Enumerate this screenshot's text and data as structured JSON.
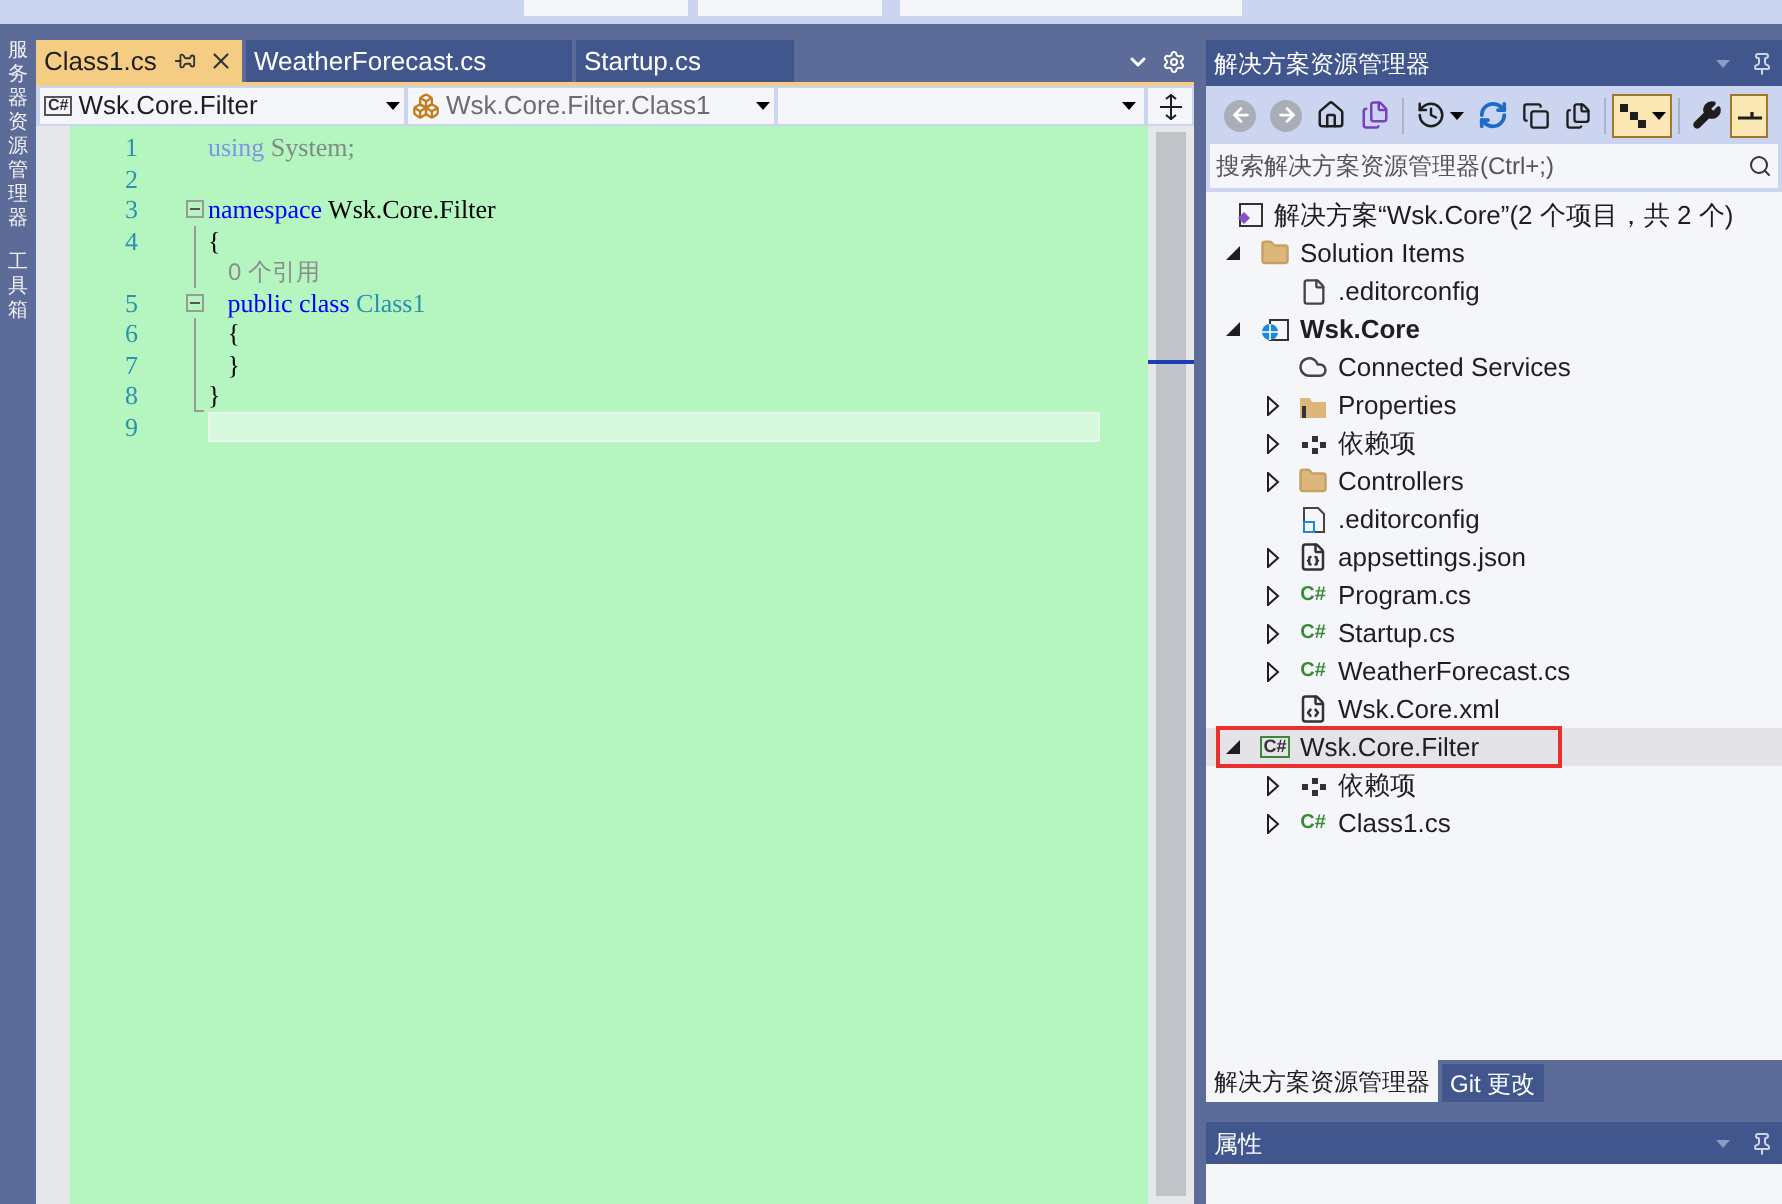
{
  "side_tabs": [
    "服务器资源管理器",
    "工具箱"
  ],
  "editor": {
    "tabs": [
      {
        "label": "Class1.cs",
        "selected": true
      },
      {
        "label": "WeatherForecast.cs",
        "selected": false
      },
      {
        "label": "Startup.cs",
        "selected": false
      }
    ],
    "nav": {
      "project_badge": "C#",
      "project": "Wsk.Core.Filter",
      "type": "Wsk.Core.Filter.Class1"
    },
    "lines": [
      {
        "number": "1",
        "kind": "plain",
        "current": false,
        "tokens": [
          {
            "text": "using",
            "kind": "faded-keyword"
          },
          {
            "text": " System;",
            "kind": "faded"
          }
        ]
      },
      {
        "number": "2",
        "kind": "plain",
        "current": false
      },
      {
        "number": "3",
        "kind": "fold-start",
        "current": false,
        "tokens": [
          {
            "text": "namespace",
            "kind": "keyword"
          },
          {
            "text": " Wsk.Core.Filter",
            "kind": "plain"
          }
        ]
      },
      {
        "number": "4",
        "kind": "fold-body",
        "current": false,
        "tokens": [
          {
            "text": "{",
            "kind": "plain"
          }
        ]
      },
      {
        "kind": "lens",
        "current": false,
        "tokens": [
          {
            "text": "   0 个引用",
            "kind": "lens"
          }
        ]
      },
      {
        "number": "5",
        "kind": "fold-start",
        "current": false,
        "tokens": [
          {
            "text": "   public",
            "kind": "keyword"
          },
          {
            "text": " class",
            "kind": "keyword"
          },
          {
            "text": " Class1",
            "kind": "type"
          }
        ]
      },
      {
        "number": "6",
        "kind": "fold-body",
        "current": false,
        "tokens": [
          {
            "text": "   {",
            "kind": "plain"
          }
        ]
      },
      {
        "number": "7",
        "kind": "fold-body",
        "current": false,
        "tokens": [
          {
            "text": "   }",
            "kind": "plain"
          }
        ]
      },
      {
        "number": "8",
        "kind": "fold-end",
        "current": false,
        "tokens": [
          {
            "text": "}",
            "kind": "plain"
          }
        ]
      },
      {
        "number": "9",
        "kind": "plain",
        "current": true
      }
    ]
  },
  "solution_explorer": {
    "title": "解决方案资源管理器",
    "toolbar": [
      {
        "kind": "back",
        "disabled": true
      },
      {
        "kind": "forward",
        "disabled": true
      },
      {
        "kind": "home"
      },
      {
        "kind": "switch"
      },
      {
        "kind": "sep"
      },
      {
        "kind": "history"
      },
      {
        "kind": "refresh"
      },
      {
        "kind": "collapse"
      },
      {
        "kind": "copy"
      },
      {
        "kind": "sep"
      },
      {
        "kind": "tree",
        "on": true
      },
      {
        "kind": "sep"
      },
      {
        "kind": "wrench"
      },
      {
        "kind": "preview",
        "on": true
      }
    ],
    "search": {
      "placeholder": "搜索解决方案资源管理器(Ctrl+;)"
    },
    "tree": {
      "label": "解决方案“Wsk.Core”(2 个项目，共 2 个)",
      "kind": "solution",
      "selected": false,
      "children": [
        {
          "label": "Solution Items",
          "kind": "folder",
          "expanded": true,
          "selected": false,
          "children": [
            {
              "label": ".editorconfig",
              "kind": "file",
              "selected": false
            }
          ]
        },
        {
          "label": "Wsk.Core",
          "kind": "web",
          "expanded": true,
          "bold": true,
          "selected": false,
          "children": [
            {
              "label": "Connected Services",
              "kind": "connected",
              "selected": false
            },
            {
              "label": "Properties",
              "kind": "properties",
              "expanded": false,
              "selected": false
            },
            {
              "label": "依赖项",
              "kind": "deps",
              "expanded": false,
              "selected": false
            },
            {
              "label": "Controllers",
              "kind": "folder",
              "expanded": false,
              "selected": false
            },
            {
              "label": ".editorconfig",
              "kind": "config",
              "selected": false
            },
            {
              "label": "appsettings.json",
              "kind": "json",
              "expanded": false,
              "selected": false
            },
            {
              "label": "Program.cs",
              "kind": "cs",
              "badge": "C#",
              "expanded": false,
              "selected": false
            },
            {
              "label": "Startup.cs",
              "kind": "cs",
              "badge": "C#",
              "expanded": false,
              "selected": false
            },
            {
              "label": "WeatherForecast.cs",
              "kind": "cs",
              "badge": "C#",
              "expanded": false,
              "selected": false
            },
            {
              "label": "Wsk.Core.xml",
              "kind": "xml",
              "selected": false
            }
          ]
        },
        {
          "label": "Wsk.Core.Filter",
          "kind": "csproj",
          "badge": "C#",
          "expanded": true,
          "selected": true,
          "highlighted": true,
          "children": [
            {
              "label": "依赖项",
              "kind": "deps",
              "expanded": false,
              "selected": false
            },
            {
              "label": "Class1.cs",
              "kind": "cs",
              "badge": "C#",
              "expanded": false,
              "selected": false
            }
          ]
        }
      ]
    },
    "bottom_tabs": [
      {
        "label": "解决方案资源管理器",
        "selected": true
      },
      {
        "label": "Git 更改",
        "selected": false
      }
    ]
  },
  "properties": {
    "title": "属性"
  }
}
